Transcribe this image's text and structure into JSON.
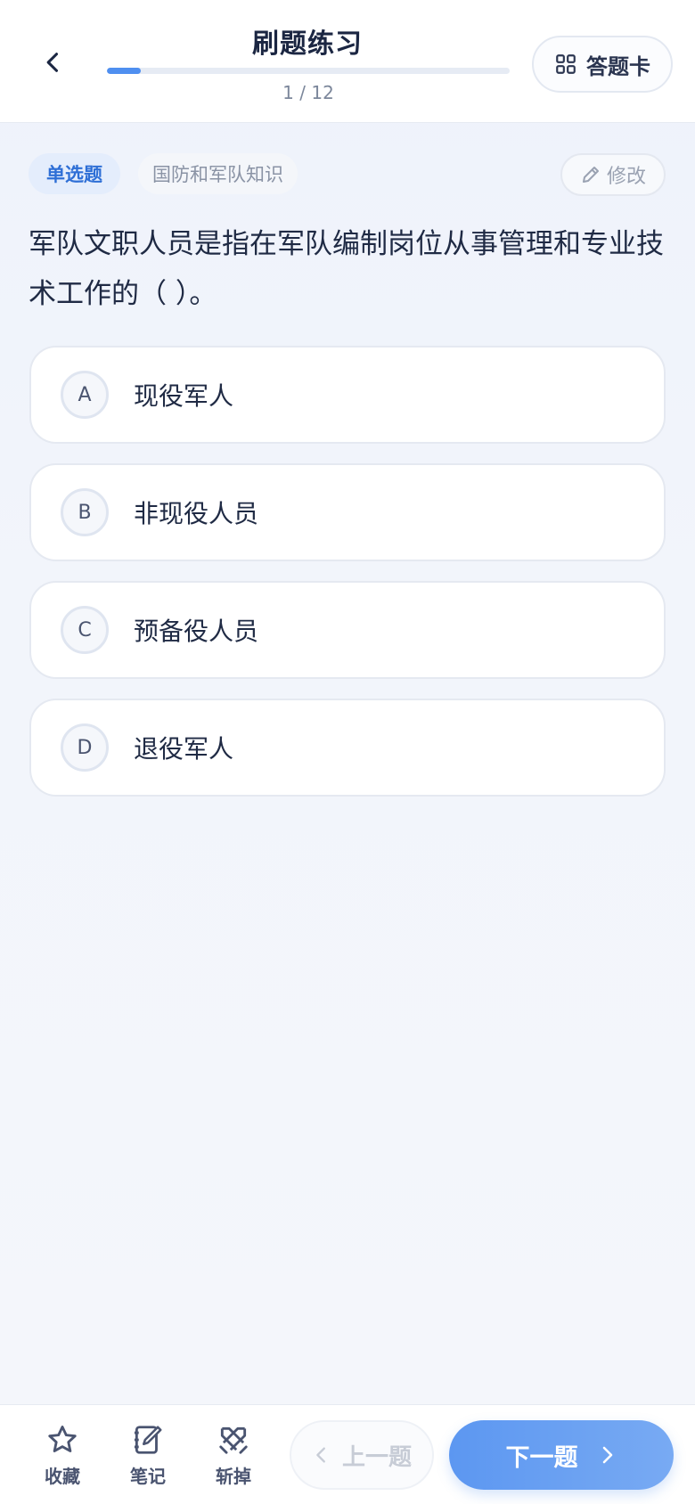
{
  "header": {
    "title": "刷题练习",
    "progress_text": "1 / 12",
    "progress_fraction": 0.083,
    "answer_card_label": "答题卡"
  },
  "question": {
    "type_tag": "单选题",
    "category_tag": "国防和军队知识",
    "edit_label": "修改",
    "text": "军队文职人员是指在军队编制岗位从事管理和专业技术工作的（ ）。",
    "options": [
      {
        "letter": "A",
        "text": "现役军人"
      },
      {
        "letter": "B",
        "text": "非现役人员"
      },
      {
        "letter": "C",
        "text": "预备役人员"
      },
      {
        "letter": "D",
        "text": "退役军人"
      }
    ]
  },
  "bottom_bar": {
    "favorite_label": "收藏",
    "note_label": "笔记",
    "remove_label": "斩掉",
    "prev_label": "上一题",
    "next_label": "下一题"
  },
  "colors": {
    "accent": "#4f8ff0",
    "tag_bg": "#e4edfc",
    "tag_text": "#2e6fd6"
  }
}
